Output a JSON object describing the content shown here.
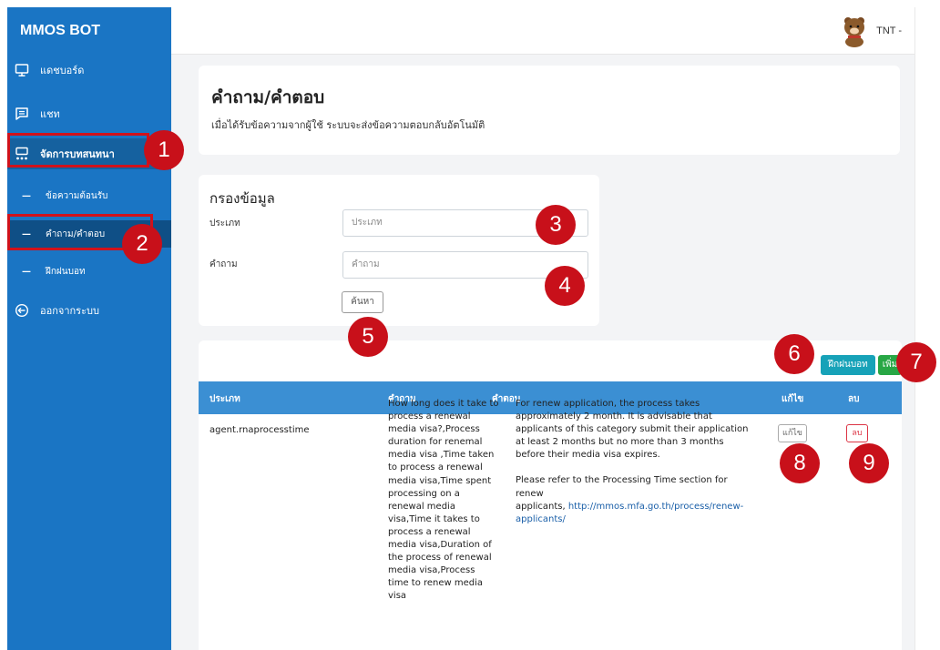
{
  "app": {
    "brand": "MMOS BOT"
  },
  "user": {
    "name": "TNT -"
  },
  "sidebar": {
    "items": [
      {
        "label": "แดชบอร์ด",
        "icon": "monitor-icon"
      },
      {
        "label": "แชท",
        "icon": "chat-icon"
      },
      {
        "label": "จัดการบทสนทนา",
        "icon": "dialog-icon"
      }
    ],
    "sub_items": [
      {
        "label": "ข้อความต้อนรับ"
      },
      {
        "label": "คำถาม/คำตอบ"
      },
      {
        "label": "ฝึกฝนบอท"
      }
    ],
    "logout": {
      "label": "ออกจากระบบ",
      "icon": "logout-icon"
    }
  },
  "page": {
    "title": "คำถาม/คำตอบ",
    "description": "เมื่อได้รับข้อความจากผู้ใช้ ระบบจะส่งข้อความตอบกลับอัตโนมัติ"
  },
  "filter": {
    "title": "กรองข้อมูล",
    "type_label": "ประเภท",
    "type_placeholder": "ประเภท",
    "question_label": "คำถาม",
    "question_placeholder": "คำถาม",
    "search_label": "ค้นหา"
  },
  "toolbar": {
    "train_label": "ฝึกฝนบอท",
    "add_label": "เพิ่ม"
  },
  "table": {
    "headers": [
      "ประเภท",
      "คำถาม",
      "คำตอบ",
      "แก้ไข",
      "ลบ"
    ],
    "rows": [
      {
        "type": "agent.rnaprocesstime",
        "question_lines": [
          "How long does it take to",
          "process a renewal",
          "media visa?,Process",
          "duration for renemal",
          "media visa ,Time taken",
          "to process a renewal",
          "media visa,Time spent",
          "processing on a",
          "renewal media",
          "visa,Time it takes to",
          "process a renewal",
          "media visa,Duration of",
          "the process of renewal",
          "media visa,Process",
          "time to renew media",
          "visa"
        ],
        "answer_lines": [
          "For renew application, the process takes",
          "approximately 2 month. It is advisable that",
          "applicants of this category submit their application",
          "at least 2 months but no more than 3 months",
          "before their media visa expires."
        ],
        "answer_ref_lines": [
          "Please refer to the Processing Time section for",
          "renew",
          "applicants,"
        ],
        "answer_link_lines": [
          "http://mmos.mfa.go.th/process/renew-",
          "applicants/"
        ],
        "edit_label": "แก้ไข",
        "delete_label": "ลบ"
      }
    ]
  },
  "annotations": [
    "1",
    "2",
    "3",
    "4",
    "5",
    "6",
    "7",
    "8",
    "9"
  ],
  "colors": {
    "sidebar": "#1a75c4",
    "table_header": "#3b8fd3",
    "annotation": "#c8101a",
    "train_button": "#17a2b8",
    "add_button": "#28a745"
  }
}
